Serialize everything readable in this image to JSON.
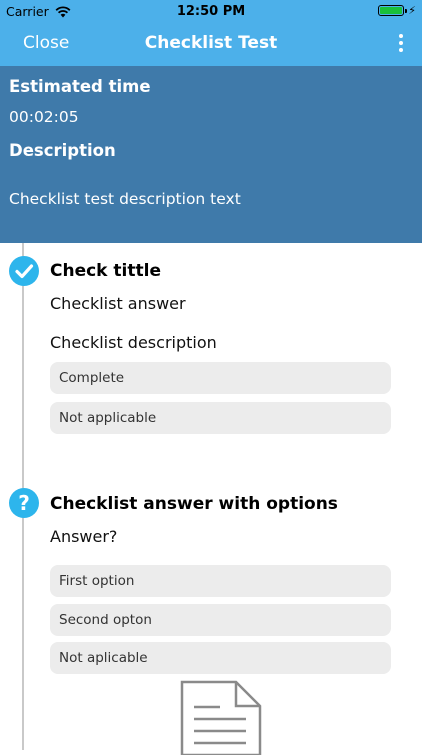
{
  "status_bar": {
    "carrier": "Carrier",
    "time": "12:50 PM"
  },
  "nav": {
    "close_label": "Close",
    "title": "Checklist Test"
  },
  "header": {
    "estimated_time_label": "Estimated time",
    "estimated_time_value": "00:02:05",
    "description_label": "Description",
    "description_value": "Checklist test description text"
  },
  "steps": [
    {
      "icon": "checkmark-icon",
      "title": "Check tittle",
      "subtitle": "Checklist answer",
      "description": "Checklist description",
      "options": [
        "Complete",
        "Not applicable"
      ]
    },
    {
      "icon": "question-icon",
      "title": "Checklist answer with options",
      "subtitle": "Answer?",
      "options": [
        "First option",
        "Second opton",
        "Not aplicable"
      ],
      "attachment_icon": "document-icon"
    }
  ],
  "colors": {
    "nav_bg": "#4cb0ea",
    "header_bg": "#3f7aaa",
    "step_icon": "#2db5ec",
    "option_bg": "#ececec",
    "battery_green": "#19c03a"
  }
}
